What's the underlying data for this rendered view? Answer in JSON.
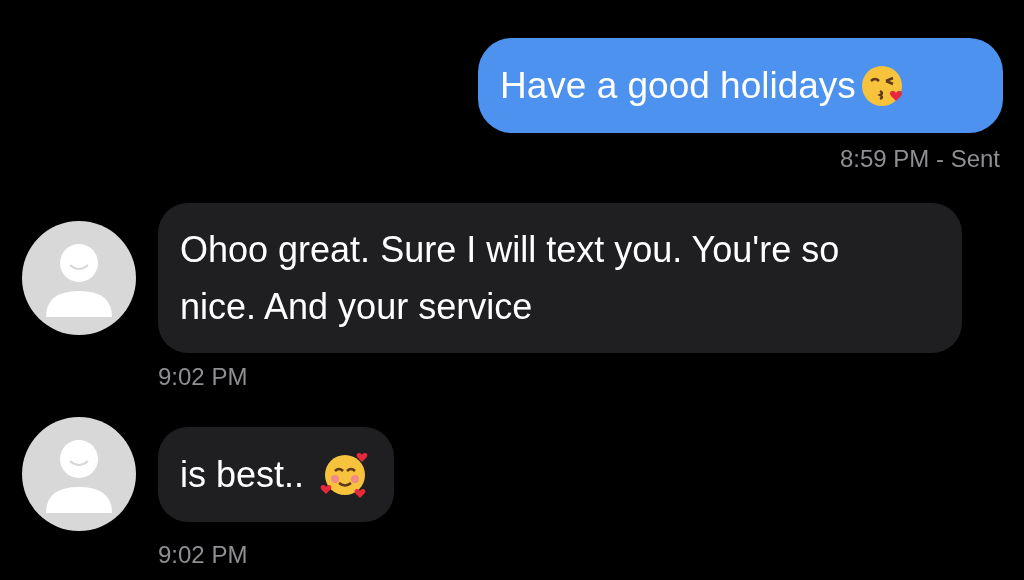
{
  "messages": [
    {
      "kind": "sent",
      "text": "Have a good holidays",
      "emoji": true,
      "footer": "8:59 PM - Sent"
    },
    {
      "kind": "received",
      "text": "Ohoo great. Sure I will text you. You're so nice. And your service",
      "emoji": false,
      "footer": "9:02 PM"
    },
    {
      "kind": "received",
      "text": "is best..",
      "emoji": true,
      "footer": "9:02 PM"
    }
  ]
}
